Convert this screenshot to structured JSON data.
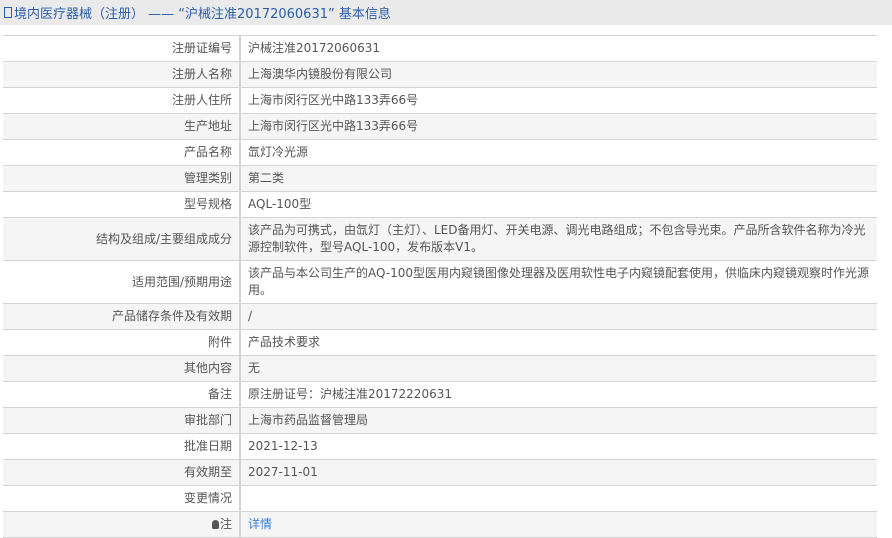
{
  "title": "境内医疗器械（注册） ——  “沪械注准20172060631” 基本信息",
  "rows": [
    {
      "label": "注册证编号",
      "value": "沪械注准20172060631"
    },
    {
      "label": "注册人名称",
      "value": "上海澳华内镜股份有限公司"
    },
    {
      "label": "注册人住所",
      "value": "上海市闵行区光中路133弄66号"
    },
    {
      "label": "生产地址",
      "value": "上海市闵行区光中路133弄66号"
    },
    {
      "label": "产品名称",
      "value": "氙灯冷光源"
    },
    {
      "label": "管理类别",
      "value": "第二类"
    },
    {
      "label": "型号规格",
      "value": "AQL-100型"
    },
    {
      "label": "结构及组成/主要组成成分",
      "value": "该产品为可携式，由氙灯（主灯）、LED备用灯、开关电源、调光电路组成；不包含导光束。产品所含软件名称为冷光源控制软件，型号AQL-100，发布版本V1。"
    },
    {
      "label": "适用范围/预期用途",
      "value": "该产品与本公司生产的AQ-100型医用内窥镜图像处理器及医用软性电子内窥镜配套使用，供临床内窥镜观察时作光源用。"
    },
    {
      "label": "产品储存条件及有效期",
      "value": "/"
    },
    {
      "label": "附件",
      "value": "产品技术要求"
    },
    {
      "label": "其他内容",
      "value": "无"
    },
    {
      "label": "备注",
      "value": "原注册证号：沪械注准20172220631"
    },
    {
      "label": "审批部门",
      "value": "上海市药品监督管理局"
    },
    {
      "label": "批准日期",
      "value": "2021-12-13"
    },
    {
      "label": "有效期至",
      "value": "2027-11-01"
    },
    {
      "label": "变更情况",
      "value": ""
    }
  ],
  "note": {
    "label": "注",
    "link": "详情"
  }
}
